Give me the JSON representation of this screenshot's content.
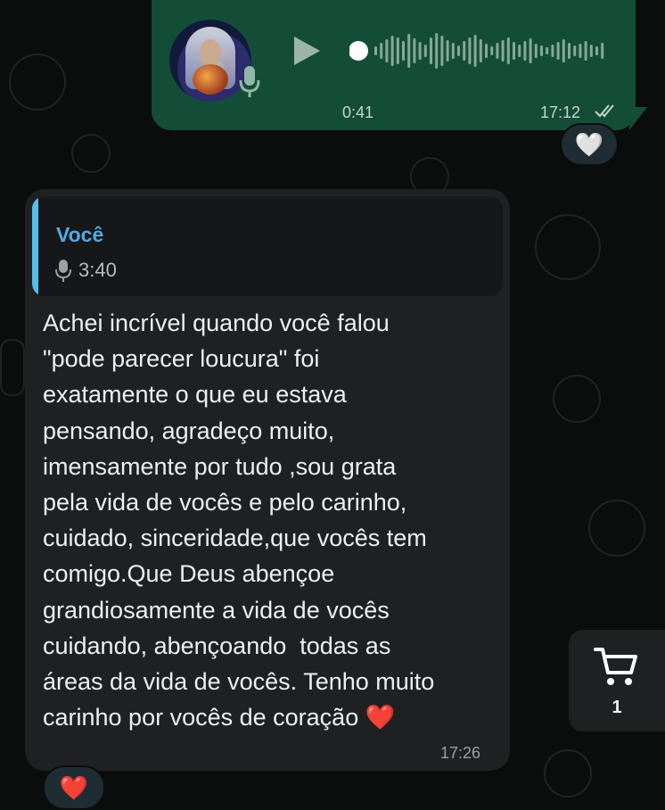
{
  "voice_message": {
    "duration": "0:41",
    "time": "17:12",
    "status": "read"
  },
  "voice_reaction": {
    "emoji": "🤍"
  },
  "text_message": {
    "quoted": {
      "author": "Você",
      "audio_duration": "3:40"
    },
    "body": "Achei incrível quando você falou\n\"pode parecer loucura\" foi\nexatamente o que eu estava\npensando, agradeço muito,\nimensamente por tudo ,sou grata\npela vida de vocês e pelo carinho,\ncuidado, sinceridade,que vocês tem\ncomigo.Que Deus abençoe\ngrandiosamente a vida de vocês\ncuidando, abençoando  todas as\náreas da vida de vocês. Tenho muito\ncarinho por vocês de coração ❤️",
    "time": "17:26"
  },
  "text_reaction": {
    "emoji": "❤️"
  },
  "cart": {
    "count": "1"
  },
  "colors": {
    "outgoing_bubble": "#144d37",
    "incoming_bubble": "#1f2022",
    "quote_accent": "#53bdeb",
    "background": "#0b0d0c"
  }
}
